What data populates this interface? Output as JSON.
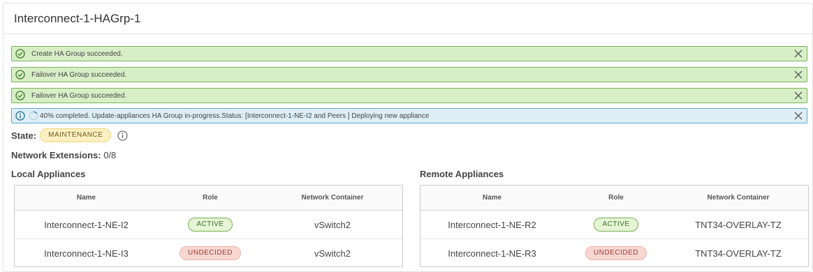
{
  "header": {
    "title": "Interconnect-1-HAGrp-1"
  },
  "alerts": [
    {
      "type": "success",
      "text": "Create HA Group succeeded.",
      "icon": "check-circle-icon"
    },
    {
      "type": "success",
      "text": "Failover HA Group succeeded.",
      "icon": "check-circle-icon"
    },
    {
      "type": "success",
      "text": "Failover HA Group succeeded.",
      "icon": "check-circle-icon"
    },
    {
      "type": "info",
      "text": "40% completed. Update-appliances HA Group in-progress.Status: [Interconnect-1-NE-I2 and Peers ] Deploying new appliance",
      "icon": "info-circle-icon",
      "progress": 0.4
    }
  ],
  "state": {
    "label": "State:",
    "value": "MAINTENANCE"
  },
  "network_extensions": {
    "label": "Network Extensions:",
    "value": "0/8"
  },
  "local": {
    "title": "Local Appliances",
    "columns": [
      "Name",
      "Role",
      "Network Container"
    ],
    "rows": [
      {
        "name": "Interconnect-1-NE-I2",
        "role": "ACTIVE",
        "container": "vSwitch2"
      },
      {
        "name": "Interconnect-1-NE-I3",
        "role": "UNDECIDED",
        "container": "vSwitch2"
      }
    ]
  },
  "remote": {
    "title": "Remote Appliances",
    "columns": [
      "Name",
      "Role",
      "Network Container"
    ],
    "rows": [
      {
        "name": "Interconnect-1-NE-R2",
        "role": "ACTIVE",
        "container": "TNT34-OVERLAY-TZ"
      },
      {
        "name": "Interconnect-1-NE-R3",
        "role": "UNDECIDED",
        "container": "TNT34-OVERLAY-TZ"
      }
    ]
  },
  "colors": {
    "success_bg": "#d8eec7",
    "success_border": "#78b35a",
    "info_bg": "#deeef7",
    "info_border": "#62a8cc",
    "active": "#72b04f",
    "undecided": "#eab2ab",
    "maintenance": "#f1d57b"
  }
}
